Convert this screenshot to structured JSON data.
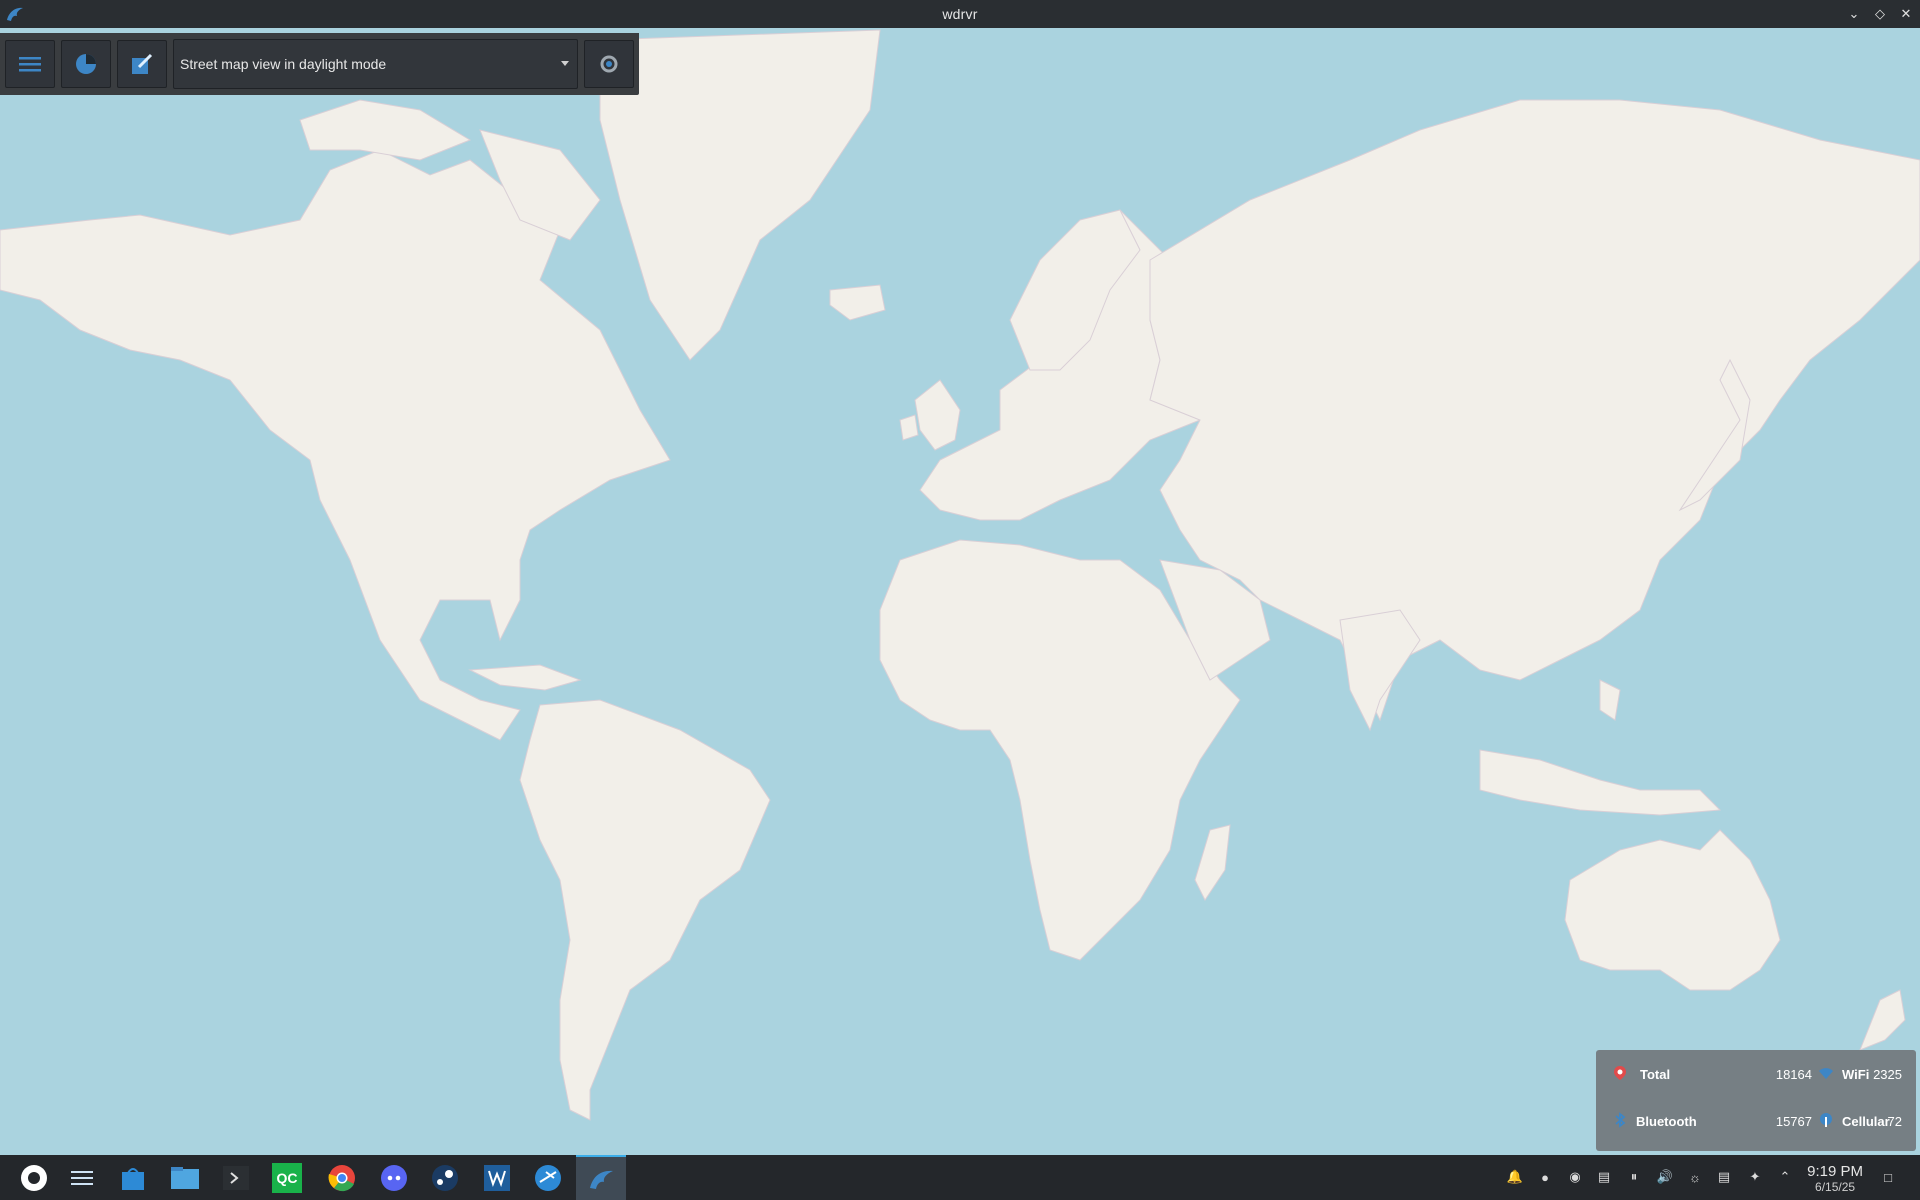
{
  "window": {
    "title": "wdrvr"
  },
  "toolbar": {
    "map_mode_selected": "Street map view in daylight mode"
  },
  "stats": {
    "total_label": "Total",
    "total_value": "18164",
    "wifi_label": "WiFi",
    "wifi_value": "2325",
    "bluetooth_label": "Bluetooth",
    "bluetooth_value": "15767",
    "cellular_label": "Cellular",
    "cellular_value": "72"
  },
  "taskbar": {
    "apps": [
      "app-launcher",
      "system-settings",
      "discover-store",
      "file-manager",
      "konsole",
      "qc",
      "chrome",
      "discord",
      "steam",
      "vm-app",
      "kdeconnect",
      "wdrvr"
    ],
    "qc_label": "QC"
  },
  "clock": {
    "time": "9:19 PM",
    "date": "6/15/25"
  },
  "colors": {
    "water": "#aad3df",
    "land": "#f2efe9",
    "border": "#c9a6bf",
    "accent": "#3daee9"
  }
}
